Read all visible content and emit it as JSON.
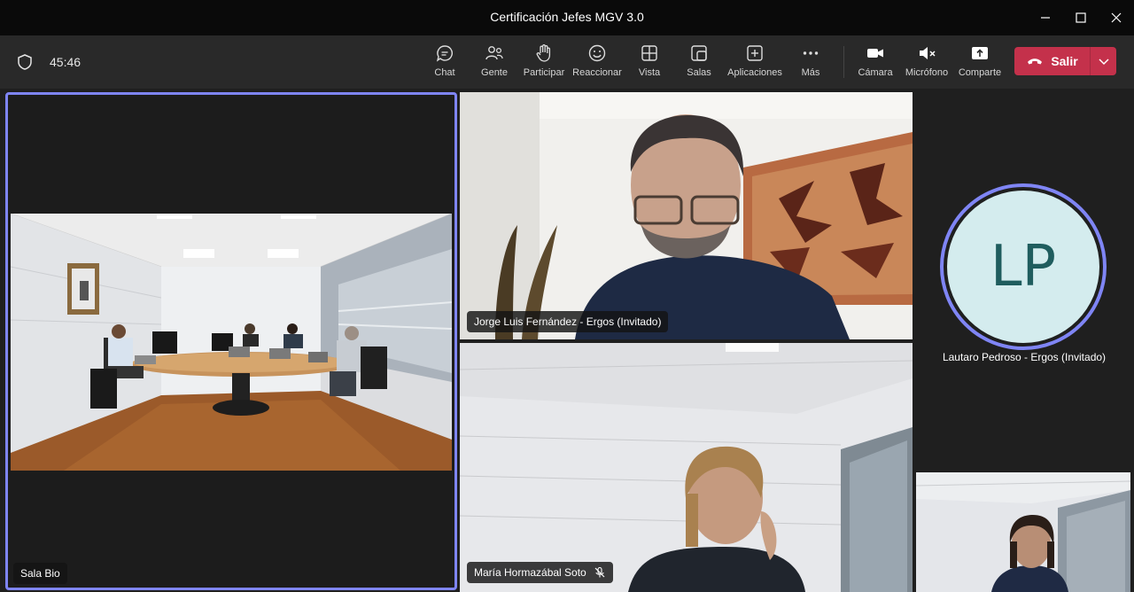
{
  "window": {
    "title": "Certificación Jefes MGV 3.0"
  },
  "toolbar": {
    "timer": "45:46",
    "buttons": [
      {
        "label": "Chat",
        "icon": "chat-icon"
      },
      {
        "label": "Gente",
        "icon": "people-icon"
      },
      {
        "label": "Participar",
        "icon": "raise-hand-icon"
      },
      {
        "label": "Reaccionar",
        "icon": "smiley-icon"
      },
      {
        "label": "Vista",
        "icon": "grid-view-icon"
      },
      {
        "label": "Salas",
        "icon": "breakout-rooms-icon"
      },
      {
        "label": "Aplicaciones",
        "icon": "add-apps-icon"
      },
      {
        "label": "Más",
        "icon": "more-icon"
      },
      {
        "label": "Cámara",
        "icon": "camera-icon"
      },
      {
        "label": "Micrófono",
        "icon": "mic-muted-icon"
      },
      {
        "label": "Comparte",
        "icon": "share-screen-icon"
      }
    ],
    "leave_label": "Salir"
  },
  "participants": {
    "sala": {
      "name": "Sala Bio"
    },
    "jorge": {
      "name": "Jorge Luis Fernández - Ergos (Invitado)"
    },
    "maria": {
      "name": "María Hormazábal Soto"
    },
    "lautaro": {
      "name": "Lautaro Pedroso - Ergos (Invitado)",
      "initials": "LP"
    }
  },
  "colors": {
    "accent": "#7f85f5",
    "leave": "#c4314b",
    "avatar_bg": "#d4ecee",
    "avatar_text": "#1f5d5e"
  }
}
